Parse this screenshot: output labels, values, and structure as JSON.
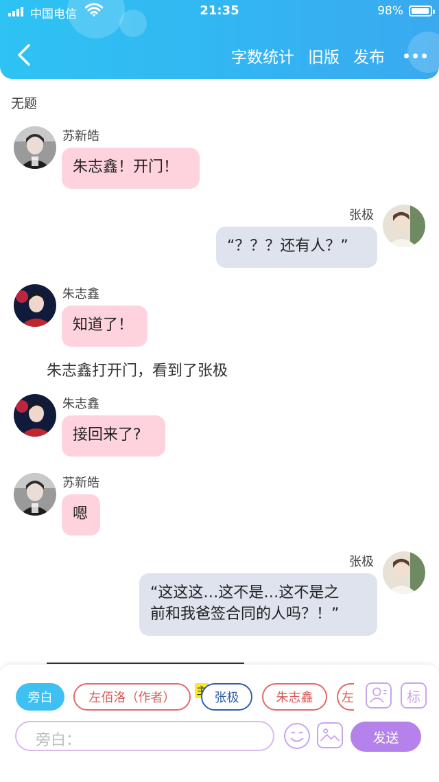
{
  "status_bar": {
    "carrier": "中国电信",
    "time": "21:35",
    "battery": "98%"
  },
  "header": {
    "actions": [
      "字数统计",
      "旧版",
      "发布"
    ]
  },
  "story": {
    "title": "无题",
    "messages": [
      {
        "speaker": "苏新皓",
        "side": "left",
        "text": "朱志鑫！开门！"
      },
      {
        "speaker": "张极",
        "side": "right",
        "text": "“？？？还有人？”"
      },
      {
        "speaker": "朱志鑫",
        "side": "left",
        "text": "知道了！"
      },
      {
        "narration": "朱志鑫打开门，看到了张极"
      },
      {
        "speaker": "朱志鑫",
        "side": "left",
        "text": "接回来了?"
      },
      {
        "speaker": "苏新皓",
        "side": "left",
        "text": "嗯"
      },
      {
        "speaker": "张极",
        "side": "right",
        "text_lines": [
          "“这这这…这不是…这不是之",
          "前和我爸签合同的人吗？！”"
        ]
      }
    ]
  },
  "composer": {
    "roles": [
      "旁白",
      "左佰洛（作者）",
      "张极",
      "朱志鑫",
      "左"
    ],
    "main_badge": "主",
    "label_icon": "标",
    "input_placeholder": "旁白：",
    "send_label": "发送"
  },
  "colors": {
    "header_blue": "#33b5f2",
    "bubble_pink": "#ffd3dd",
    "bubble_gray": "#dee3ed",
    "send_purple": "#b482ea",
    "active_chip": "#3ec0f2"
  }
}
